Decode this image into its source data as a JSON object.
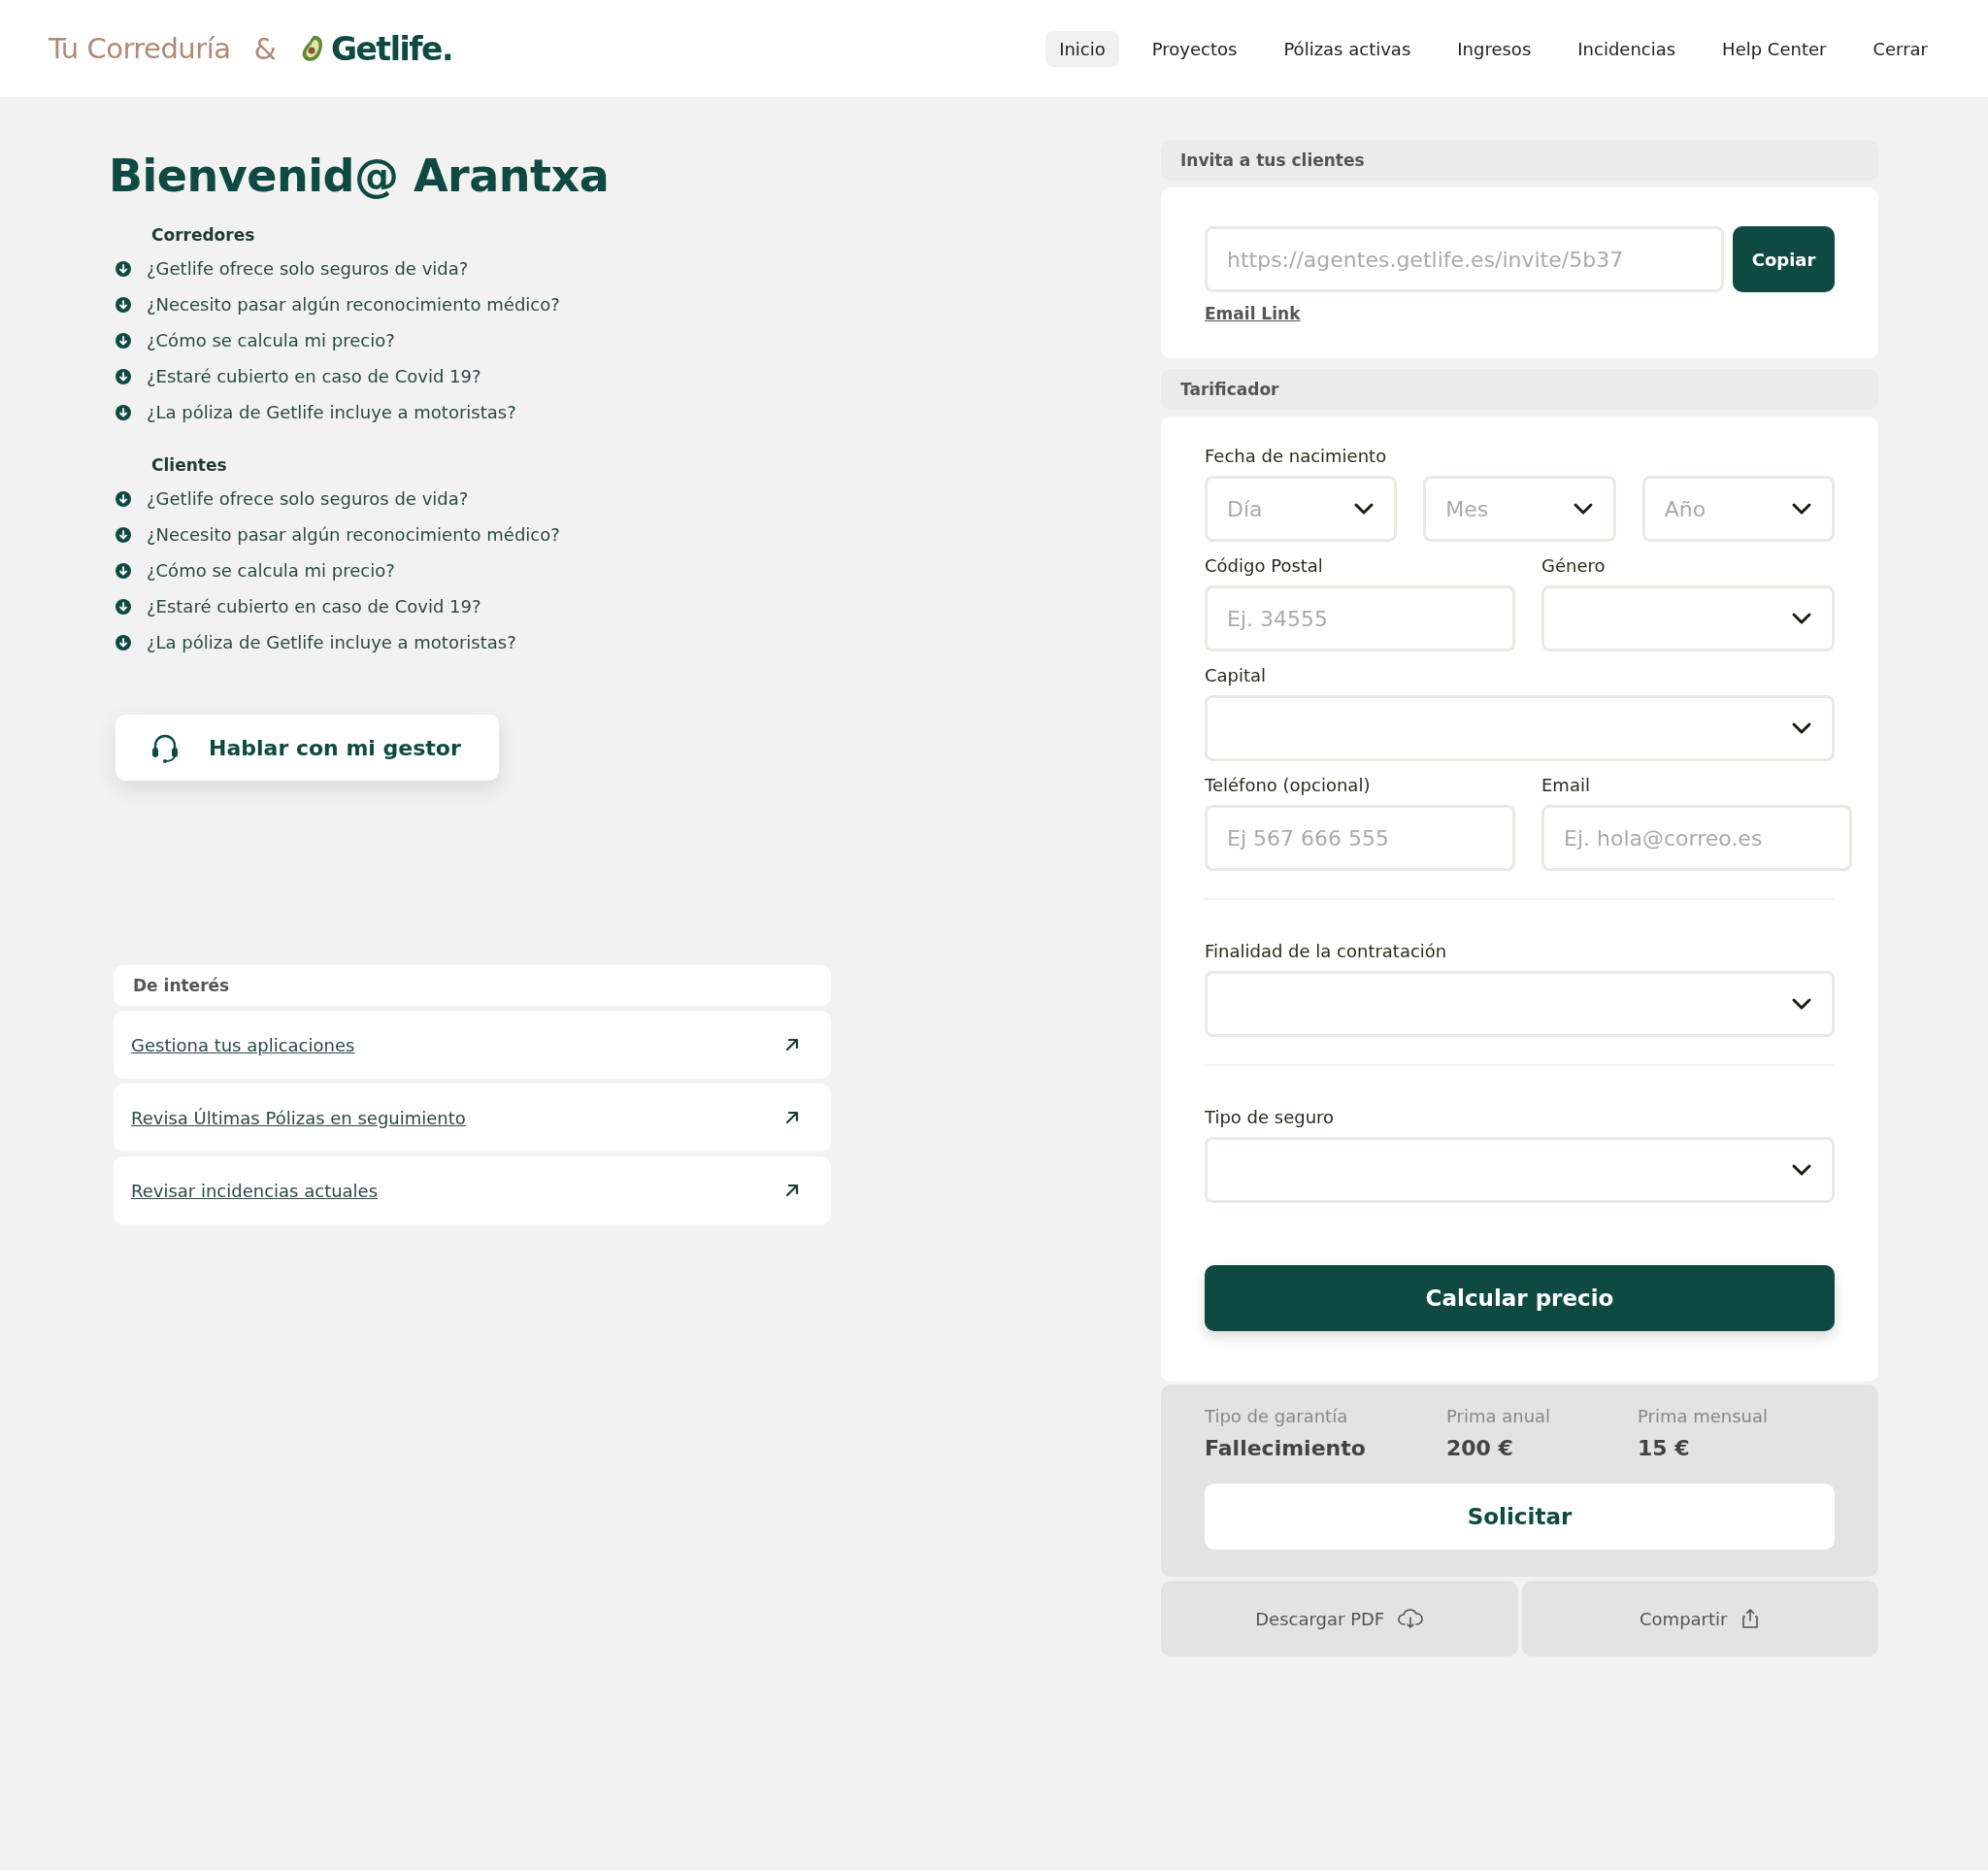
{
  "header": {
    "brand": {
      "partner": "Tu Correduría",
      "joiner": "&",
      "name": "Getlife."
    },
    "nav": [
      {
        "label": "Inicio",
        "selected": true
      },
      {
        "label": "Proyectos",
        "selected": false
      },
      {
        "label": "Pólizas activas",
        "selected": false
      },
      {
        "label": "Ingresos",
        "selected": false
      },
      {
        "label": "Incidencias",
        "selected": false
      },
      {
        "label": "Help Center",
        "selected": false
      },
      {
        "label": "Cerrar",
        "selected": false
      }
    ]
  },
  "welcome": {
    "title": "Bienvenid@ Arantxa"
  },
  "faq": [
    {
      "heading": "Corredores",
      "items": [
        "¿Getlife ofrece solo seguros de vida?",
        "¿Necesito pasar algún reconocimiento médico?",
        "¿Cómo se calcula mi precio?",
        "¿Estaré cubierto en caso de Covid 19?",
        "¿La póliza de Getlife incluye a motoristas?"
      ]
    },
    {
      "heading": "Clientes",
      "items": [
        "¿Getlife ofrece solo seguros de vida?",
        "¿Necesito pasar algún reconocimiento médico?",
        "¿Cómo se calcula mi precio?",
        "¿Estaré cubierto en caso de Covid 19?",
        "¿La póliza de Getlife incluye a motoristas?"
      ]
    }
  ],
  "contact_button": "Hablar con mi gestor",
  "interest": {
    "heading": "De interés",
    "links": [
      "Gestiona tus aplicaciones",
      "Revisa Últimas Pólizas en seguimiento",
      "Revisar incidencias actuales"
    ]
  },
  "invite": {
    "heading": "Invita a tus clientes",
    "link": "https://agentes.getlife.es/invite/5b37",
    "copy_button": "Copiar",
    "email_link": "Email Link"
  },
  "quote_form": {
    "heading": "Tarificador",
    "groups": [
      {
        "rows": [
          {
            "cells": [
              {
                "label": "Fecha de nacimiento",
                "controls": [
                  {
                    "kind": "select",
                    "placeholder": "Día"
                  },
                  {
                    "kind": "select",
                    "placeholder": "Mes"
                  },
                  {
                    "kind": "select",
                    "placeholder": "Año"
                  }
                ]
              }
            ]
          },
          {
            "cells": [
              {
                "label": "Código Postal",
                "controls": [
                  {
                    "kind": "text",
                    "placeholder": "Ej. 34555"
                  }
                ]
              },
              {
                "label": "Género",
                "controls": [
                  {
                    "kind": "select"
                  }
                ]
              }
            ]
          },
          {
            "cells": [
              {
                "label": "Capital",
                "controls": [
                  {
                    "kind": "select"
                  }
                ]
              }
            ]
          },
          {
            "cells": [
              {
                "label": "Teléfono (opcional)",
                "controls": [
                  {
                    "kind": "text",
                    "placeholder": "Ej 567 666 555"
                  }
                ]
              },
              {
                "label": "Email",
                "controls": [
                  {
                    "kind": "text",
                    "placeholder": "Ej. hola@correo.es"
                  }
                ]
              }
            ]
          }
        ]
      },
      {
        "rows": [
          {
            "cells": [
              {
                "label": "Finalidad de la contratación",
                "controls": [
                  {
                    "kind": "select"
                  }
                ]
              }
            ]
          }
        ]
      },
      {
        "rows": [
          {
            "cells": [
              {
                "label": "Tipo de seguro",
                "controls": [
                  {
                    "kind": "select"
                  }
                ]
              }
            ]
          }
        ]
      }
    ],
    "submit": "Calcular precio"
  },
  "result": {
    "columns": [
      {
        "label": "Tipo de garantía",
        "value": "Fallecimiento"
      },
      {
        "label": "Prima anual",
        "value": "200 €"
      },
      {
        "label": "Prima mensual",
        "value": "15 €"
      }
    ],
    "button": "Solicitar"
  },
  "actions": [
    {
      "kind": "download",
      "label": "Descargar PDF"
    },
    {
      "kind": "share",
      "label": "Compartir"
    }
  ]
}
